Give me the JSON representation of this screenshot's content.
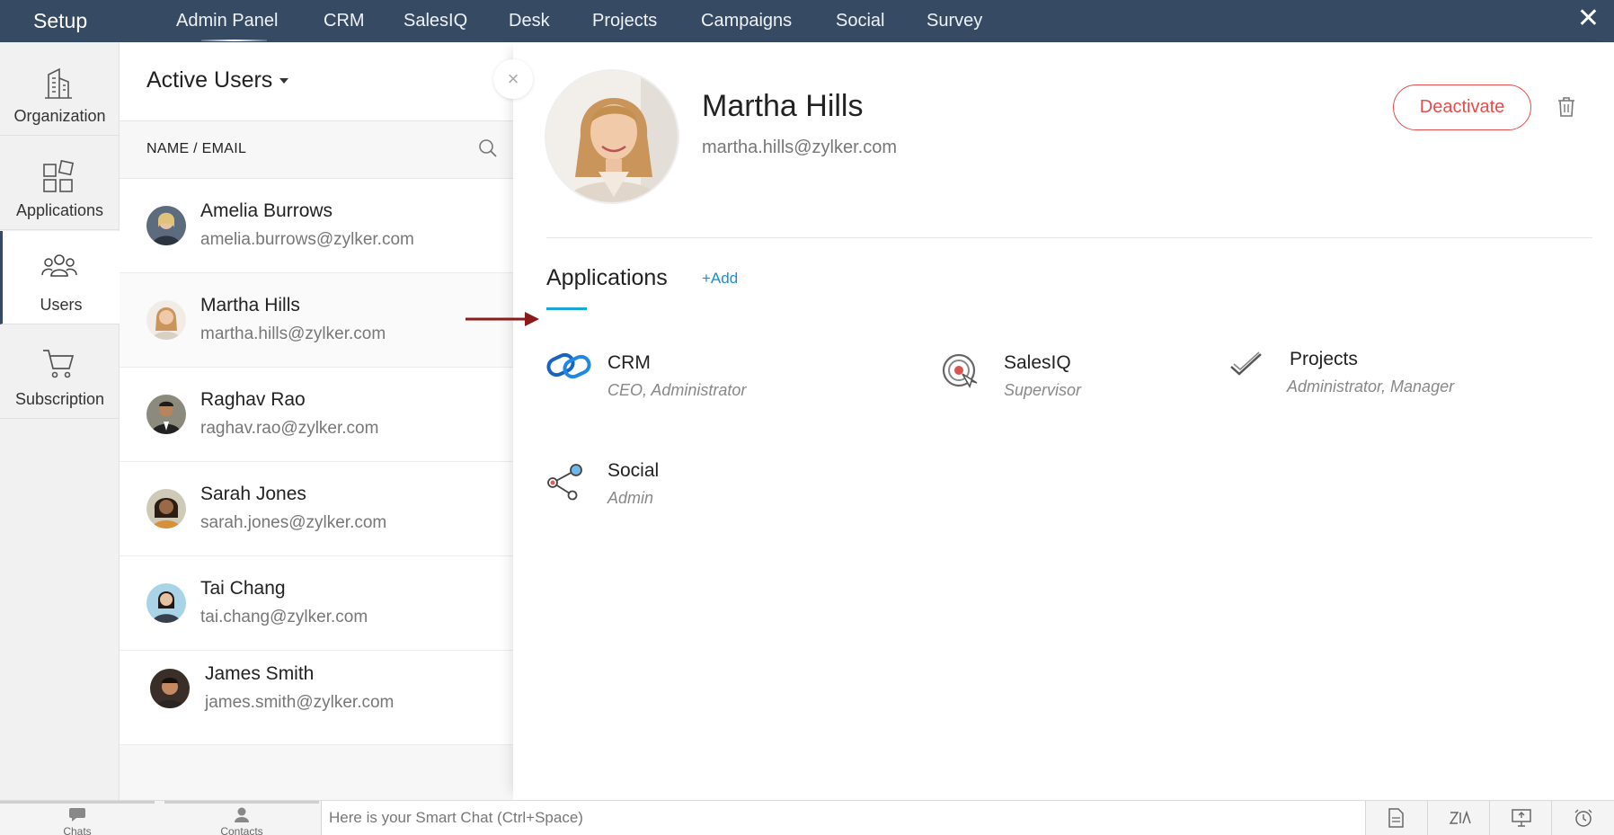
{
  "topbar": {
    "setup": "Setup",
    "nav": [
      "Admin Panel",
      "CRM",
      "SalesIQ",
      "Desk",
      "Projects",
      "Campaigns",
      "Social",
      "Survey"
    ],
    "active_nav": "Admin Panel"
  },
  "sidebar": {
    "items": [
      {
        "label": "Organization",
        "icon": "building-icon"
      },
      {
        "label": "Applications",
        "icon": "apps-grid-icon"
      },
      {
        "label": "Users",
        "icon": "users-icon"
      },
      {
        "label": "Subscription",
        "icon": "cart-icon"
      }
    ],
    "active": "Users"
  },
  "userlist": {
    "title": "Active Users",
    "column_label": "NAME / EMAIL",
    "users": [
      {
        "name": "Amelia Burrows",
        "email": "amelia.burrows@zylker.com"
      },
      {
        "name": "Martha Hills",
        "email": "martha.hills@zylker.com"
      },
      {
        "name": "Raghav Rao",
        "email": "raghav.rao@zylker.com"
      },
      {
        "name": "Sarah Jones",
        "email": "sarah.jones@zylker.com"
      },
      {
        "name": "Tai Chang",
        "email": "tai.chang@zylker.com"
      },
      {
        "name": "James Smith",
        "email": "james.smith@zylker.com"
      }
    ],
    "selected": "Martha Hills"
  },
  "detail": {
    "name": "Martha Hills",
    "email": "martha.hills@zylker.com",
    "deactivate_label": "Deactivate",
    "applications_title": "Applications",
    "add_label": "+Add",
    "apps": [
      {
        "name": "CRM",
        "role": "CEO, Administrator",
        "icon": "crm-icon"
      },
      {
        "name": "SalesIQ",
        "role": "Supervisor",
        "icon": "salesiq-icon"
      },
      {
        "name": "Projects",
        "role": "Administrator, Manager",
        "icon": "projects-check-icon"
      },
      {
        "name": "Social",
        "role": "Admin",
        "icon": "social-share-icon"
      }
    ]
  },
  "bottombar": {
    "tabs": [
      "Chats",
      "Contacts"
    ],
    "smart_chat_placeholder": "Here is your Smart Chat (Ctrl+Space)"
  },
  "colors": {
    "topbar": "#374a63",
    "deactivate": "#e84b4b",
    "accent": "#1ba7d5",
    "link": "#1a8fd4"
  }
}
